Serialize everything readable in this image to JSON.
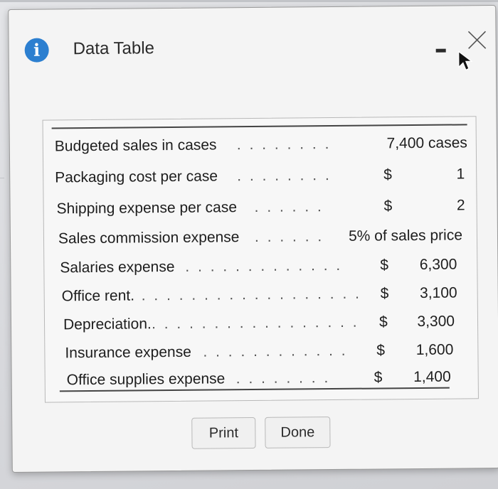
{
  "dialog": {
    "title": "Data Table",
    "icons": {
      "info": "info-icon",
      "minimize": "minimize-icon",
      "close": "close-icon",
      "cursor": "mouse-cursor-icon"
    },
    "colors": {
      "info_icon": "#2c7fd0",
      "background": "#f4f4f4"
    }
  },
  "table": {
    "rows": [
      {
        "label": "Budgeted sales in cases",
        "dots": ". . . . . . . .",
        "value": "7,400 cases"
      },
      {
        "label": "Packaging cost per case",
        "dots": ". . . . . . . .",
        "currency": "$",
        "amount": "1"
      },
      {
        "label": "Shipping expense per case",
        "dots": ". . . . . .",
        "currency": "$",
        "amount": "2"
      },
      {
        "label": "Sales commission expense",
        "dots": ". . . . . .",
        "value": "5% of sales price"
      },
      {
        "label": "Salaries expense",
        "dots": ". . . . . . . . . . . . .",
        "currency": "$",
        "amount": "6,300"
      },
      {
        "label": "Office rent.",
        "dots": ". . . . . . . . . . . . . . . . . .",
        "currency": "$",
        "amount": "3,100"
      },
      {
        "label": "Depreciation.",
        "dots": ". . . . . . . . . . . . . . . . .",
        "currency": "$",
        "amount": "3,300"
      },
      {
        "label": "Insurance expense",
        "dots": ". . . . . . . . . . . .",
        "currency": "$",
        "amount": "1,600"
      },
      {
        "label": "Office supplies expense",
        "dots": ". . . . . . . .",
        "currency": "$",
        "amount": "1,400"
      }
    ]
  },
  "buttons": {
    "print": "Print",
    "done": "Done"
  }
}
